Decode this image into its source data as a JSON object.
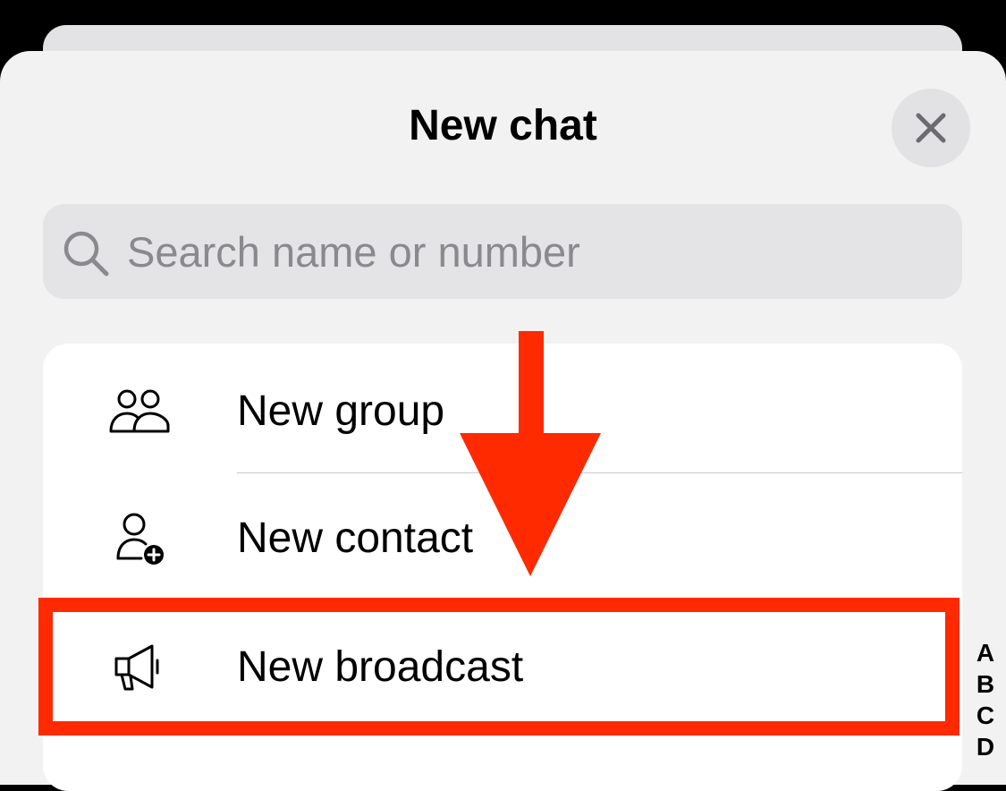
{
  "sheet": {
    "title": "New chat",
    "close_icon": "close-icon"
  },
  "search": {
    "placeholder": "Search name or number",
    "icon": "search-icon"
  },
  "menu": {
    "items": [
      {
        "label": "New group",
        "icon": "group-icon"
      },
      {
        "label": "New contact",
        "icon": "add-contact-icon"
      },
      {
        "label": "New broadcast",
        "icon": "megaphone-icon"
      }
    ]
  },
  "annotation": {
    "color": "#ff2a00",
    "highlighted_item": "New broadcast"
  },
  "index_bar": {
    "letters": [
      "A",
      "B",
      "C",
      "D"
    ]
  }
}
